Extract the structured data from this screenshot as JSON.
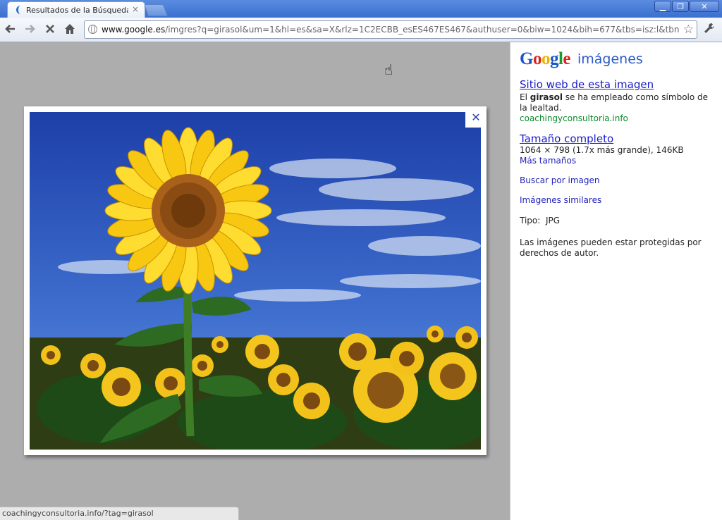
{
  "browser": {
    "tab_title": "Resultados de la Búsqueda de",
    "tab_close": "×",
    "window_buttons": {
      "minimize": "▁",
      "maximize": "❐",
      "close": "✕"
    },
    "url_host": "www.google.es",
    "url_path": "/imgres?q=girasol&um=1&hl=es&sa=X&rlz=1C2ECBB_esES467ES467&authuser=0&biw=1024&bih=677&tbs=isz:l&tbn"
  },
  "viewer": {
    "close_label": "✕",
    "image_icon": "sunflower-photo"
  },
  "panel": {
    "logo": {
      "g1": "G",
      "o1": "o",
      "o2": "o",
      "g2": "g",
      "l": "l",
      "e": "e"
    },
    "logo_sub": "imágenes",
    "site_link": "Sitio web de esta imagen",
    "desc_pre": "El ",
    "desc_bold": "girasol",
    "desc_post": " se ha empleado como símbolo de la lealtad.",
    "source_domain": "coachingyconsultoria.info",
    "full_size_link": "Tamaño completo",
    "dimensions": "1064 × 798 (1.7x más grande), 146KB",
    "more_sizes": "Más tamaños",
    "search_by_image": "Buscar por imagen",
    "similar_images": "Imágenes similares",
    "type_label": "Tipo:",
    "type_value": "JPG",
    "copyright": "Las imágenes pueden estar protegidas por derechos de autor."
  },
  "status_url": "coachingyconsultoria.info/?tag=girasol",
  "colors": {
    "link": "#1a1ac8",
    "green": "#0a8a2a",
    "chrome_blue": "#3b6fcf"
  }
}
